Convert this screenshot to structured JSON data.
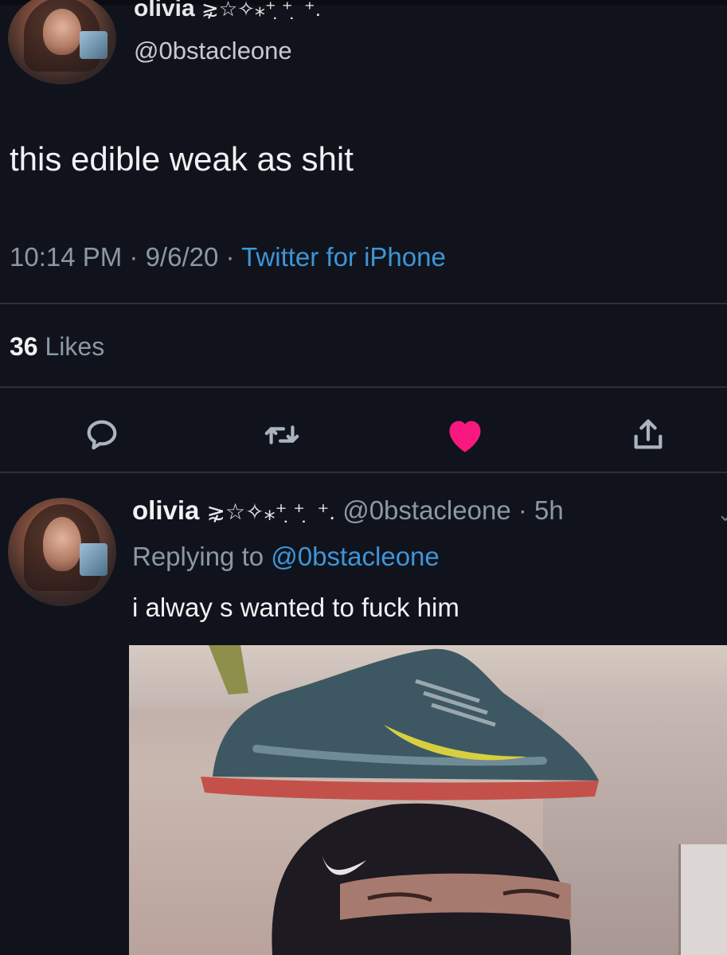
{
  "tweet": {
    "display_name": "olivia",
    "name_decoration": "⋧☆✧⁎⁺ ̣⁺ ̣ ⁺.",
    "handle": "@0bstacleone",
    "text": "this edible weak as shit",
    "time": "10:14 PM",
    "date": "9/6/20",
    "separator": " · ",
    "source": "Twitter for iPhone",
    "likes_count": "36",
    "likes_label": "Likes",
    "liked": true
  },
  "actions": {
    "reply_icon": "reply-icon",
    "retweet_icon": "retweet-icon",
    "like_icon": "heart-icon",
    "share_icon": "share-icon"
  },
  "reply": {
    "display_name": "olivia",
    "name_decoration": "⋧☆✧⁎⁺ ̣⁺ ̣ ⁺.",
    "handle": "@0bstacleone",
    "time": "5h",
    "replying_prefix": "Replying to",
    "replying_to": "@0bstacleone",
    "text": "i alway s wanted to fuck him",
    "media_description_icon": "photo"
  },
  "colors": {
    "background": "#10131b",
    "link": "#3d95d8",
    "like": "#f91880",
    "muted": "#8b98a5"
  }
}
